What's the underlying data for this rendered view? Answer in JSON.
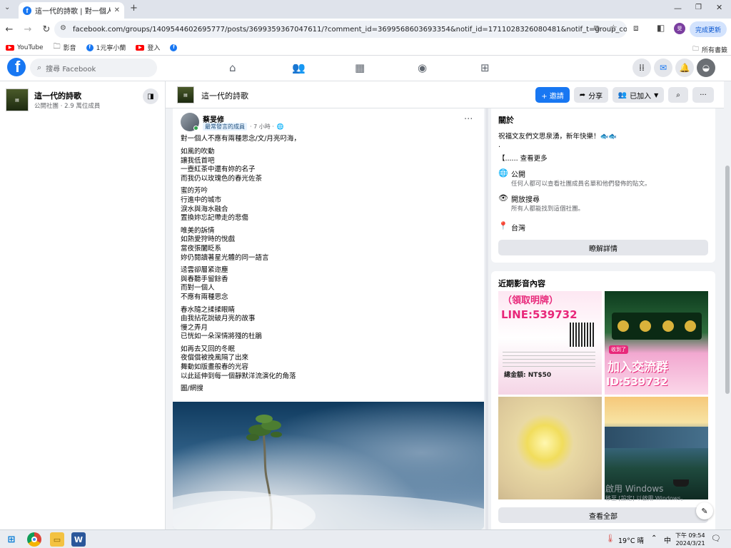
{
  "browser": {
    "tab_title": "這一代的詩歌 | 對一個人不應有",
    "url": "facebook.com/groups/1409544602695777/posts/3699359367047611/?comment_id=3699568603693354&notif_id=1711028326080481&notif_t=group_comment",
    "update_label": "完成更新",
    "bookmarks": [
      {
        "label": "YouTube",
        "icon": "youtube-icon"
      },
      {
        "label": "影音",
        "icon": "folder-icon"
      },
      {
        "label": "1元寧小蘭",
        "icon": "facebook-icon"
      },
      {
        "label": "登入",
        "icon": "youtube-icon"
      }
    ],
    "all_bookmarks": "所有書籤"
  },
  "fb": {
    "search_placeholder": "搜尋 Facebook"
  },
  "group": {
    "name": "這一代的詩歌",
    "meta": "公開社團 · 2.9 萬位成員",
    "invite_label": "+ 邀請",
    "share_label": "分享",
    "joined_label": "已加入"
  },
  "post": {
    "author": "蔡旻修",
    "badge": "最常發言的成員",
    "time": "· 7 小時 ·",
    "title": "對一個人不應有兩種思念/文/月亮叼海，",
    "stanzas": [
      [
        "如風的吹動",
        "讓我低首吧",
        "一壺紅茶中還有妳的名子",
        "而我仍以玫瑰色的春光佐茶"
      ],
      [
        "蜜的芳吟",
        "行進中的城市",
        "淚水與海水融合",
        "置換妳忘記帶走的悲傷"
      ],
      [
        "唯美的訴情",
        "如熱愛狩時的悅戲",
        "當夜張闔眨系",
        "妳仍閱讀著星光體的同一語言"
      ],
      [
        "迳雲卻層紧迩塵",
        "與春聽手留餘香",
        "而對一個人",
        "不應有兩種思念"
      ],
      [
        "春水隨之揉揉眼睛",
        "由我拈花說破月亮的故事",
        "慢之弄月",
        "已恍如一朵深情將殘的杜鵑"
      ],
      [
        "如再去又回的冬眠",
        "夜償償被挽風隔了出來",
        "舞動如版畫般春的光容",
        "以此延伸到每一個靜默洋流演化的角落"
      ]
    ],
    "photo_credit": "圖/網搜"
  },
  "about": {
    "heading": "關於",
    "desc": "祝福文友們文思泉湧，新年快樂！🐟🐟",
    "dot": ".",
    "more": "【...... 查看更多",
    "public_title": "公開",
    "public_desc": "任何人都可以查看社團成員名單和他們發佈的貼文。",
    "visible_title": "開放搜尋",
    "visible_desc": "所有人都能找到這個社團。",
    "location": "台灣",
    "learn_more": "瞭解詳情"
  },
  "media": {
    "heading": "近期影音內容",
    "tile1_top": "（領取明牌）",
    "tile1_line": "LINE:539732",
    "tile1_small": "總金額: NT$50",
    "tile2_top": "收到了",
    "tile2_main": "加入交流群",
    "tile2_id": "ID:539732",
    "view_all": "查看全部"
  },
  "watermark": {
    "line1": "啟用 Windows",
    "line2": "移至 [設定] 以啟用 Windows。"
  },
  "taskbar": {
    "weather": "19°C 晴",
    "ime": "中",
    "time": "下午 09:54",
    "date": "2024/3/21"
  }
}
